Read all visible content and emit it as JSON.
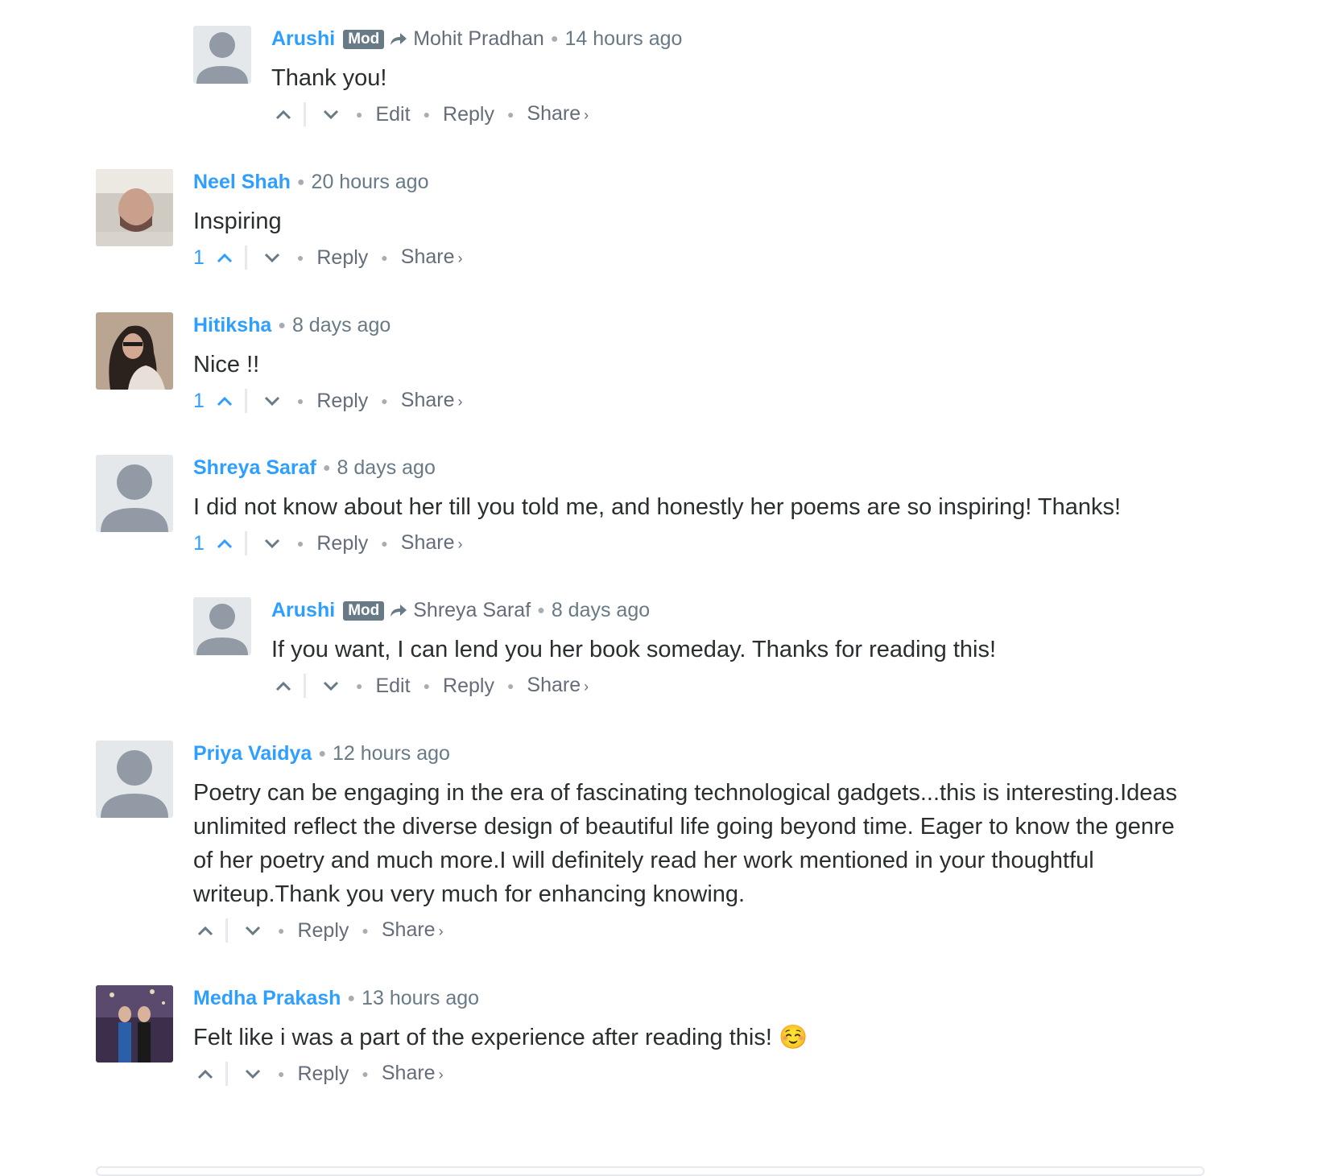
{
  "colors": {
    "author": "#2e9fff",
    "meta": "#687a86",
    "text": "#2a2e2e",
    "accent": "#2e9fff"
  },
  "comments": [
    {
      "author": "Arushi",
      "mod": "Mod",
      "parent": "Mohit Pradhan",
      "time": "14 hours ago",
      "text": "Thank you!",
      "count": "",
      "actions": {
        "edit": "Edit",
        "reply": "Reply",
        "share": "Share"
      },
      "avatar": "default-avatar"
    },
    {
      "author": "Neel Shah",
      "time": "20 hours ago",
      "text": "Inspiring",
      "count": "1",
      "actions": {
        "reply": "Reply",
        "share": "Share"
      },
      "avatar": "photo-avatar"
    },
    {
      "author": "Hitiksha",
      "time": "8 days ago",
      "text": "Nice !!",
      "count": "1",
      "actions": {
        "reply": "Reply",
        "share": "Share"
      },
      "avatar": "photo-avatar"
    },
    {
      "author": "Shreya Saraf",
      "time": "8 days ago",
      "text": "I did not know about her till you told me, and honestly her poems are so inspiring! Thanks!",
      "count": "1",
      "actions": {
        "reply": "Reply",
        "share": "Share"
      },
      "avatar": "default-avatar"
    },
    {
      "author": "Arushi",
      "mod": "Mod",
      "parent": "Shreya Saraf",
      "time": "8 days ago",
      "text": "If you want, I can lend you her book someday. Thanks for reading this!",
      "count": "",
      "actions": {
        "edit": "Edit",
        "reply": "Reply",
        "share": "Share"
      },
      "avatar": "default-avatar"
    },
    {
      "author": "Priya Vaidya",
      "time": "12 hours ago",
      "text": "Poetry can be engaging in the era of fascinating technological gadgets...this is interesting.Ideas unlimited reflect the diverse design of beautiful life going beyond time. Eager to know the genre of her poetry and much more.I will definitely read her work mentioned in your thoughtful writeup.Thank you very much for enhancing knowing.",
      "count": "",
      "actions": {
        "reply": "Reply",
        "share": "Share"
      },
      "avatar": "default-avatar"
    },
    {
      "author": "Medha Prakash",
      "time": "13 hours ago",
      "text": "Felt like i was a part of the experience after reading this! ☺️",
      "count": "",
      "actions": {
        "reply": "Reply",
        "share": "Share"
      },
      "avatar": "photo-avatar"
    }
  ],
  "icons": {
    "upvote": "chevron-up-icon",
    "downvote": "chevron-down-icon",
    "reply_to": "reply-arrow-icon",
    "share_more": "chevron-right-icon"
  }
}
